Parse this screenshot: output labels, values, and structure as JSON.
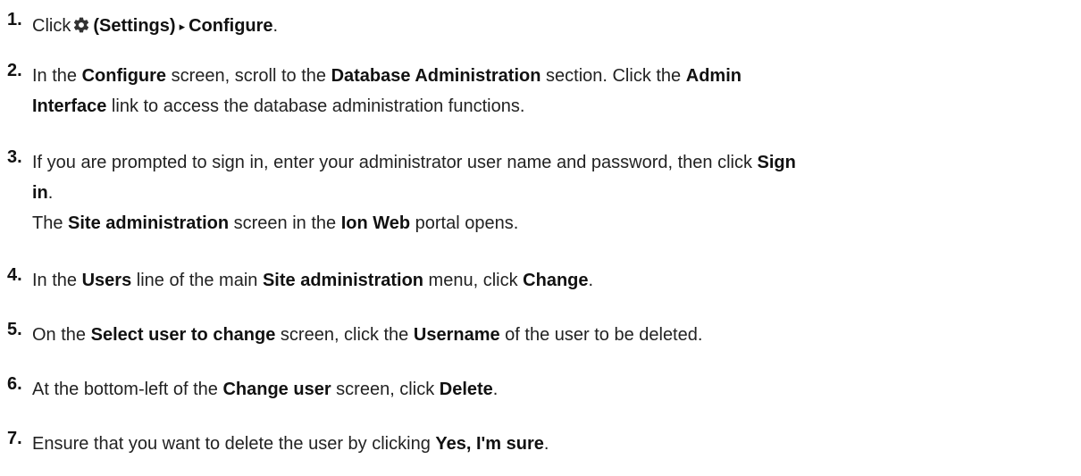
{
  "steps": [
    {
      "number": "1.",
      "lines": [
        {
          "t1": "Click",
          "icon": "gear-icon",
          "b1": "(Settings)",
          "caret": "▸",
          "b2": "Configure",
          "t2": "."
        }
      ]
    },
    {
      "number": "2.",
      "lines": [
        {
          "t1": "In the ",
          "b1": "Configure",
          "t2": " screen, scroll to the ",
          "b2": "Database Administration",
          "t3": " section. Click the ",
          "b3": "Admin"
        },
        {
          "b1": "Interface",
          "t1": " link to access the database administration functions."
        }
      ]
    },
    {
      "number": "3.",
      "lines": [
        {
          "t1": "If you are prompted to sign in, enter your administrator user name and password, then click ",
          "b1": "Sign"
        },
        {
          "b1": "in",
          "t1": "."
        },
        {
          "t1": "The ",
          "b1": "Site administration",
          "t2": " screen in the ",
          "b2": "Ion Web",
          "t3": " portal opens."
        }
      ]
    },
    {
      "number": "4.",
      "lines": [
        {
          "t1": "In the ",
          "b1": "Users",
          "t2": " line of the main ",
          "b2": "Site administration",
          "t3": " menu, click ",
          "b3": "Change",
          "t4": "."
        }
      ]
    },
    {
      "number": "5.",
      "lines": [
        {
          "t1": "On the ",
          "b1": "Select user to change",
          "t2": " screen, click the ",
          "b2": "Username",
          "t3": " of the user to be deleted."
        }
      ]
    },
    {
      "number": "6.",
      "lines": [
        {
          "t1": "At the bottom-left of the ",
          "b1": "Change user",
          "t2": " screen, click ",
          "b2": "Delete",
          "t3": "."
        }
      ]
    },
    {
      "number": "7.",
      "lines": [
        {
          "t1": "Ensure that you want to delete the user by clicking ",
          "b1": "Yes, I'm sure",
          "t2": "."
        }
      ]
    }
  ]
}
